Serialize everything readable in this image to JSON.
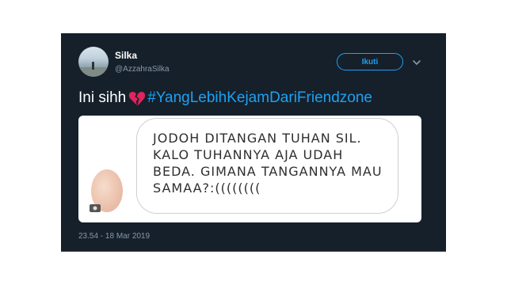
{
  "tweet": {
    "author": {
      "display_name": "Silka",
      "handle": "@AzzahraSilka"
    },
    "follow_label": "Ikuti",
    "text": {
      "prefix": "Ini sihh",
      "emoji": "broken-heart-icon",
      "hashtag": "#YangLebihKejamDariFriendzone"
    },
    "media": {
      "chat_lines": [
        "JODOH DITANGAN TUHAN SIL.",
        "KALO TUHANNYA AJA UDAH",
        "BEDA. GIMANA TANGANNYA MAU",
        "SAMAA?:(((((((("
      ]
    },
    "timestamp": "23.54 - 18 Mar 2019"
  },
  "colors": {
    "background": "#15202b",
    "accent": "#1da1f2",
    "secondary_text": "#8899a6",
    "heart": "#e0245e"
  }
}
